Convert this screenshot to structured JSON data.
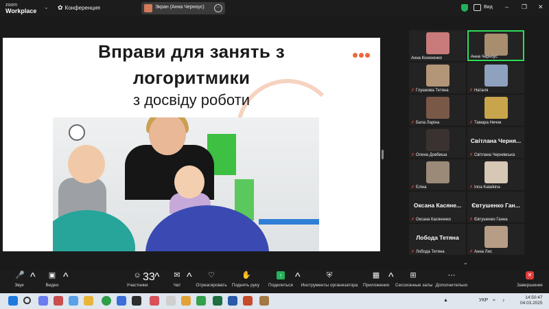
{
  "app": {
    "logo_line1": "zoom",
    "logo_line2": "Workplace",
    "conference": "Конференция",
    "view": "Вид"
  },
  "share": {
    "label": "Экран (Анна Черноус)"
  },
  "slide": {
    "title_line1": "Вправи для занять з",
    "title_line2": "логоритмики",
    "subtitle": "з досвіду роботи",
    "accent_color": "#e96a3c"
  },
  "gallery": {
    "tiles": [
      {
        "name": "Анна Кононенко",
        "muted": false,
        "type": "video",
        "face": "#c97a7a"
      },
      {
        "name": "Анна Черноус",
        "muted": false,
        "type": "video",
        "face": "#a88d6e",
        "active": true
      },
      {
        "name": "Глушкова Тетяна",
        "muted": true,
        "type": "video",
        "face": "#b39577"
      },
      {
        "name": "Наталя",
        "muted": true,
        "type": "video",
        "face": "#8ea2bf"
      },
      {
        "name": "Бела Ларіна",
        "muted": true,
        "type": "video",
        "face": "#7a5848"
      },
      {
        "name": "Тамара Ничик",
        "muted": true,
        "type": "video",
        "face": "#c8a54c"
      },
      {
        "name": "Олена Довбиша",
        "muted": true,
        "type": "video",
        "face": "#3a3131"
      },
      {
        "name": "Світлана Черня...",
        "caption": "Світлана Чернявська",
        "muted": true,
        "type": "text"
      },
      {
        "name": "Еліна",
        "muted": true,
        "type": "video",
        "face": "#9b8a78"
      },
      {
        "name": "Inna Kalaikina",
        "muted": true,
        "type": "video",
        "face": "#d7c7b5"
      },
      {
        "name": "Оксана Касяне...",
        "caption": "Оксана Касяненко",
        "muted": true,
        "type": "text"
      },
      {
        "name": "Євтушенко Ган...",
        "caption": "Євтушенко Ганна",
        "muted": true,
        "type": "text"
      },
      {
        "name": "Лобода Тетяна",
        "caption": "Лобода Тетяна",
        "muted": true,
        "type": "text"
      },
      {
        "name": "Анна Лис",
        "muted": true,
        "type": "video",
        "face": "#b79d86"
      }
    ]
  },
  "toolbar": {
    "audio": "Звук",
    "video": "Видео",
    "participants": "Участники",
    "participants_count": "33",
    "chat": "Чат",
    "react": "Отреагировать",
    "raise_hand": "Поднять руку",
    "share": "Поделиться",
    "host_tools": "Инструменты организатора",
    "apps": "Приложения",
    "breakout": "Сессионные залы",
    "more": "Дополнительно",
    "end": "Завершение"
  },
  "taskbar": {
    "lang": "УКР",
    "time": "14:50:47",
    "date": "04.03.2025"
  },
  "colors": {
    "green": "#2fdc5a",
    "share_green": "#22b35a",
    "end_red": "#e23a3a"
  }
}
